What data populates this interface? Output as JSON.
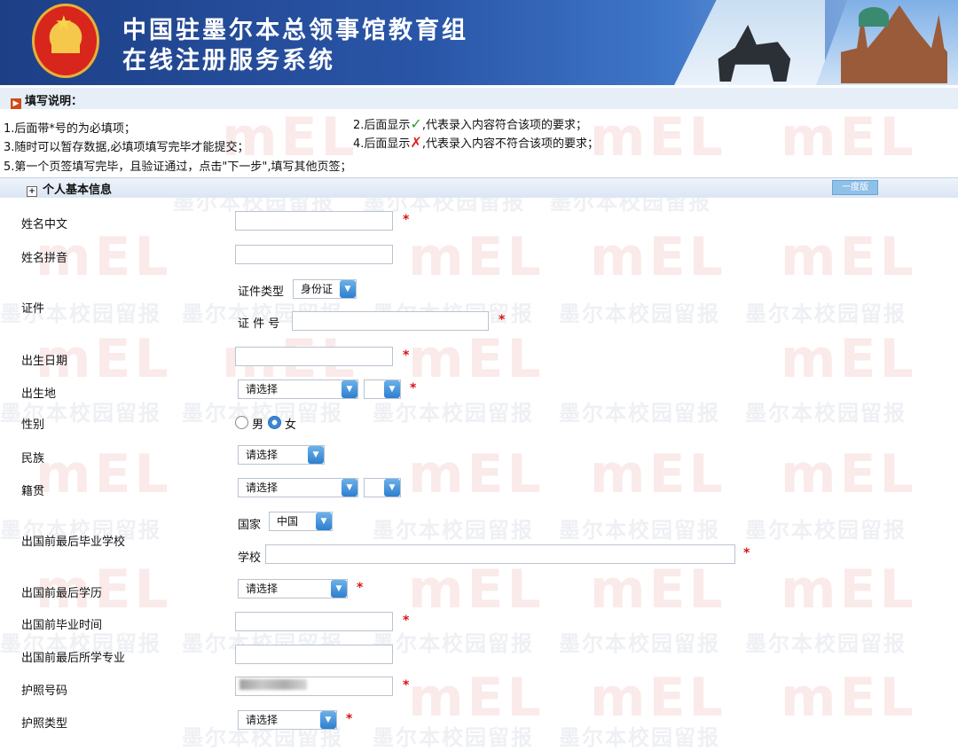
{
  "header": {
    "title_line1": "中国驻墨尔本总领事馆教育组",
    "title_line2": "在线注册服务系统"
  },
  "instructions": {
    "heading": "填写说明：",
    "item1": "1.后面带*号的为必填项；",
    "item2_a": "2.后面显示",
    "item2_b": ",代表录入内容符合该项的要求；",
    "item3": "3.随时可以暂存数据,必填项填写完毕才能提交；",
    "item4_a": "4.后面显示",
    "item4_b": ",代表录入内容不符合该项的要求；",
    "item5": "5.第一个页签填写完毕，且验证通过，点击\"下一步\",填写其他页签；",
    "ok_mark": "✓",
    "bad_mark": "✗"
  },
  "section": {
    "title": "个人基本信息",
    "plus": "+",
    "button_label": "一度版"
  },
  "form": {
    "required_mark": "*",
    "name_cn_label": "姓名中文",
    "name_pinyin_label": "姓名拼音",
    "id_label": "证件",
    "id_type_label": "证件类型",
    "id_type_value": "身份证",
    "id_no_label": "证 件 号",
    "birth_date_label": "出生日期",
    "birthplace_label": "出生地",
    "birthplace_value": "请选择",
    "gender_label": "性别",
    "gender_male": "男",
    "gender_female": "女",
    "ethnicity_label": "民族",
    "ethnicity_value": "请选择",
    "native_label": "籍贯",
    "native_value": "请选择",
    "school_label": "出国前最后毕业学校",
    "country_label": "国家",
    "country_value": "中国",
    "school_sub_label": "学校",
    "edu_label": "出国前最后学历",
    "edu_value": "请选择",
    "grad_time_label": "出国前毕业时间",
    "major_label": "出国前最后所学专业",
    "passport_no_label": "护照号码",
    "passport_type_label": "护照类型",
    "passport_type_value": "请选择"
  },
  "watermark": {
    "logo": "mEL",
    "text": "墨尔本校园留报"
  },
  "colors": {
    "banner": "#2a56a8",
    "required": "#dd1111",
    "select_arrow": "#2d7fd0"
  },
  "icons": {
    "dropdown": "chevron-down-icon",
    "ok": "check-icon",
    "bad": "cross-icon"
  }
}
